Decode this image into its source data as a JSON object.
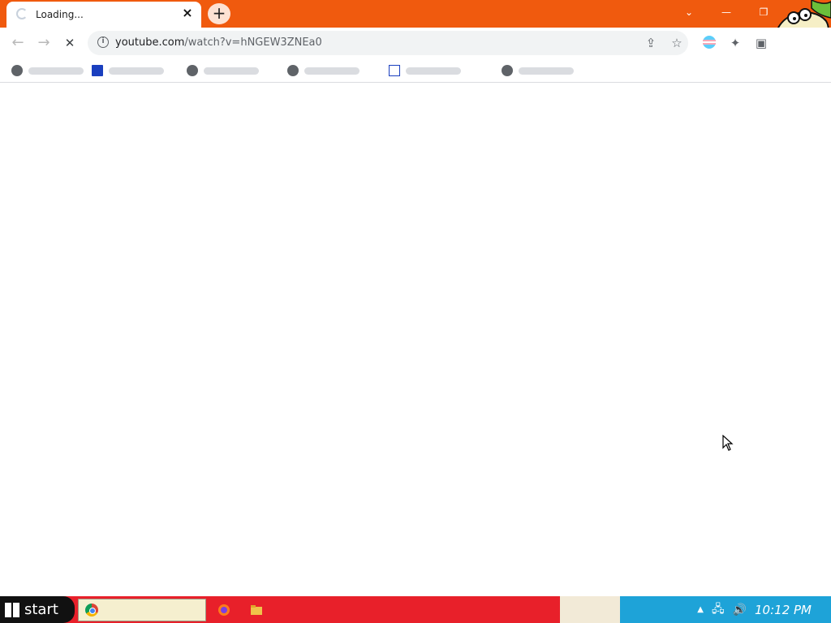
{
  "tab": {
    "title": "Loading...",
    "close": "×"
  },
  "new_tab": "+",
  "window_controls": [
    "⌄",
    "—",
    "❐"
  ],
  "toolbar": {
    "back": "←",
    "forward": "→",
    "stop": "✕",
    "url_host": "youtube.com",
    "url_path": "/watch?v=hNGEW3ZNEa0",
    "info_icon": "i"
  },
  "toolbar_icons": [
    "share-icon",
    "star-icon",
    "profile-avatar-icon",
    "extensions-icon",
    "side-panel-icon"
  ],
  "bookmarks": [
    {
      "icon": "globe-icon",
      "label": ""
    },
    {
      "icon": "mf-icon",
      "label": ""
    },
    {
      "icon": "globe-icon",
      "label": ""
    },
    {
      "icon": "globe-icon",
      "label": ""
    },
    {
      "icon": "sigma-icon",
      "label": ""
    },
    {
      "icon": "globe-icon",
      "label": ""
    }
  ],
  "taskbar": {
    "start_label": "start",
    "tray_arrow": "▲",
    "clock": "10:12 PM"
  }
}
